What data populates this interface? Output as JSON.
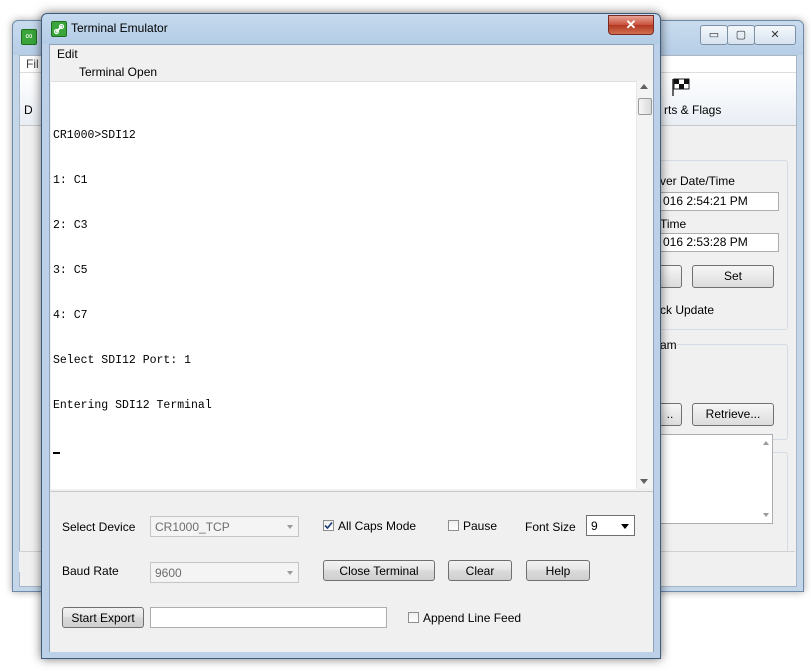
{
  "background_window": {
    "menu_file": "Fil",
    "toolbar_partial": "D",
    "toolbar_flags": "rts & Flags",
    "server_datetime_label": "ver Date/Time",
    "server_datetime_value": "016 2:54:21 PM",
    "time_label": "Time",
    "time_value": "016 2:53:28 PM",
    "set_label": "Set",
    "clock_update_label": "ck Update",
    "program_label": "am",
    "send_partial": "..",
    "retrieve_label": "Retrieve...",
    "min_glyph": "▭",
    "max_glyph": "▢",
    "close_glyph": "✕",
    "icon": "link-icon",
    "flags_icon": "checkered-flag-icon"
  },
  "terminal_window": {
    "title": "Terminal Emulator",
    "title_icon": "link-icon",
    "close_glyph": "✕",
    "menu": {
      "edit": "Edit"
    },
    "status": "Terminal Open",
    "output_lines": [
      "CR1000>SDI12",
      "1: C1",
      "2: C3",
      "3: C5",
      "4: C7",
      "Select SDI12 Port: 1",
      "Entering SDI12 Terminal"
    ],
    "controls": {
      "select_device_label": "Select Device",
      "select_device_value": "CR1000_TCP",
      "all_caps_label": "All Caps Mode",
      "all_caps_checked": true,
      "pause_label": "Pause",
      "pause_checked": false,
      "font_size_label": "Font Size",
      "font_size_value": "9",
      "baud_rate_label": "Baud Rate",
      "baud_rate_value": "9600",
      "close_terminal_label": "Close Terminal",
      "clear_label": "Clear",
      "help_label": "Help",
      "start_export_label": "Start Export",
      "export_path_value": "",
      "append_line_feed_label": "Append Line Feed",
      "append_line_feed_checked": false
    }
  }
}
